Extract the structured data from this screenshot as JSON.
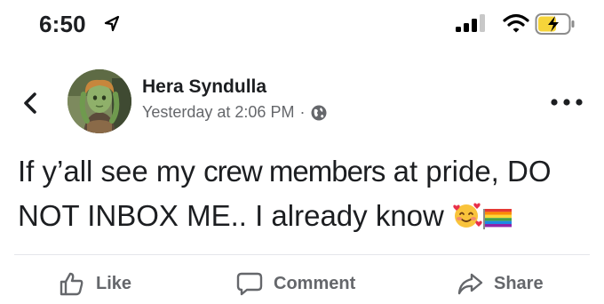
{
  "status_bar": {
    "time": "6:50"
  },
  "post": {
    "author": "Hera Syndulla",
    "timestamp": "Yesterday at 2:06 PM",
    "separator": "·",
    "text_part1": "If y’all see my ",
    "text_highlight": "crew members",
    "text_part2": " at pride, DO NOT INBOX ME.. I already know"
  },
  "actions": {
    "like": "Like",
    "comment": "Comment",
    "share": "Share"
  },
  "icons": {
    "back": "chevron-left-icon",
    "more": "more-dots-icon",
    "privacy": "globe-icon",
    "emoji": "smiling-face-with-hearts-icon",
    "flag": "rainbow-flag-icon",
    "like": "thumbs-up-icon",
    "comment": "speech-bubble-icon",
    "share": "share-arrow-icon"
  }
}
